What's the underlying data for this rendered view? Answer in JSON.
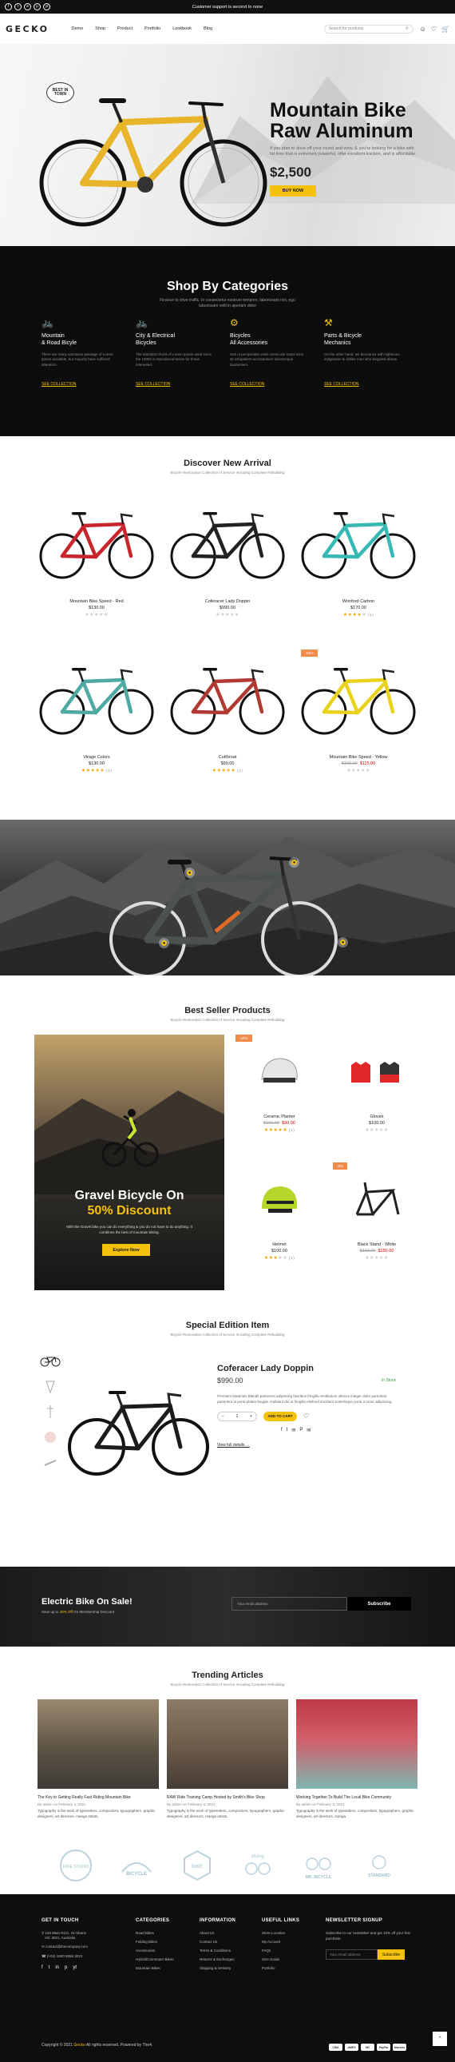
{
  "topbar": {
    "social": [
      "f",
      "t",
      "in",
      "p",
      "yt"
    ],
    "message": "Customer support is second to none"
  },
  "header": {
    "logo": "GECKO",
    "nav": [
      "Demo",
      "Shop",
      "Product",
      "Portfolio",
      "Lookbook",
      "Blog"
    ],
    "search_placeholder": "Search for products",
    "icons": [
      "user-icon",
      "heart-icon",
      "cart-icon"
    ]
  },
  "hero": {
    "bubble": "BEST IN TOWN",
    "title_line1": "Mountain Bike",
    "title_line2": "Raw Aluminum",
    "desc": "If you plan to drive off your round and wow, & you're looking for a bike with fat tires that is extremely powerful, offer excellent traction, and is affordable.",
    "price": "$2,500",
    "button": "BUY NOW"
  },
  "categories": {
    "title": "Shop By Categories",
    "subtitle": "Finance to drive traffic. In consectetur nostrum tempore, laboriosam nisi, ego laboriosam velit in aperiam dolor",
    "items": [
      {
        "name_line1": "Mountain",
        "name_line2": "& Road Bicyle",
        "desc": "There are many variations passage of Lorem Ipsum available, but majority have suffered alteration.",
        "link": "SEE COLLECTION"
      },
      {
        "name_line1": "City & Electrical",
        "name_line2": "Bicycles",
        "desc": "The standard chunk of Lorem Ipsum used since the 1500s is reproduced below for those interested.",
        "link": "SEE COLLECTION"
      },
      {
        "name_line1": "Bicycles",
        "name_line2": "All Accessories",
        "desc": "Sed ut perspiciatis unde omnis iste natus error sit voluptatem accusantium doloremque laudantium.",
        "link": "SEE COLLECTION"
      },
      {
        "name_line1": "Parts & Bicycle",
        "name_line2": "Mechanics",
        "desc": "On the other hand, we denounce with righteous indignation & dislike men who beguiled abuse.",
        "link": "SEE COLLECTION"
      }
    ]
  },
  "arrivals": {
    "title": "Discover New Arrival",
    "subtitle": "Bicycle Restoration Collection of Service Including Complete Rebuilding",
    "products": [
      {
        "name": "Mountain Bike Speed - Red",
        "price": "$130.00",
        "old": "",
        "rating": 0,
        "count": "",
        "badge": "",
        "frame": "#c8262c"
      },
      {
        "name": "Coferacer Lady Doppin",
        "price": "$990.00",
        "old": "",
        "rating": 0,
        "count": "",
        "badge": "",
        "frame": "#222222"
      },
      {
        "name": "Wonford Carbon",
        "price": "$170.00",
        "old": "",
        "rating": 4,
        "count": "(1)",
        "badge": "",
        "frame": "#36b9b5"
      },
      {
        "name": "Virage Colors",
        "price": "$130.00",
        "old": "",
        "rating": 5,
        "count": "(1)",
        "badge": "",
        "frame": "#4ea9a3"
      },
      {
        "name": "Cutthroat",
        "price": "$99.00",
        "old": "",
        "rating": 5,
        "count": "(1)",
        "badge": "",
        "frame": "#b03a32"
      },
      {
        "name": "Mountain Bike Speed - Yellow",
        "price": "$115.00",
        "old": "$100.00",
        "rating": 0,
        "count": "",
        "badge": "-15%",
        "frame": "#e8d21c"
      }
    ]
  },
  "bestseller": {
    "title": "Best Seller Products",
    "subtitle": "Bicycle Restoration Collection of Service Including Complete Rebuilding",
    "promo_title_line1": "Gravel Bicycle On",
    "promo_highlight": "50% Discount",
    "promo_desc": "With the Gravel bike you can do everything & you do not have to do anything. It combines the best of mountain biking.",
    "promo_button": "Explore Now",
    "products": [
      {
        "name": "Ceramic Planter",
        "price": "$90.00",
        "old": "$100.00",
        "rating": 5,
        "count": "(1)",
        "badge": "-10%"
      },
      {
        "name": "Gloves",
        "price": "$100.00",
        "old": "",
        "rating": 0,
        "count": "",
        "badge": ""
      },
      {
        "name": "Helmet",
        "price": "$100.00",
        "old": "",
        "rating": 3,
        "count": "(1)",
        "badge": ""
      },
      {
        "name": "Black Stand - White",
        "price": "$150.00",
        "old": "$160.00",
        "rating": 0,
        "count": "",
        "badge": "-6%"
      }
    ]
  },
  "special": {
    "title": "Special Edition Item",
    "subtitle": "Bicycle Restoration Collection of Service Including Complete Rebuilding",
    "name": "Coferacer Lady Doppin",
    "price": "$990.00",
    "stock": "In Stock",
    "desc": "Premium Materials Blandit parturient adipiscing faucibus fringilla vestibulum ultrices integer dolor parturient parturient at porta platea feugiat. Habitant dui ut fringilla eleifend tincidunt scelerisque porta a tortor adipiscing.",
    "qty": "1",
    "add_to_cart": "ADD TO CART",
    "view_link": "View full details →",
    "shares": [
      "f",
      "t",
      "✉",
      "P",
      "✉"
    ]
  },
  "ebike": {
    "title": "Electric Bike On Sale!",
    "sub_pre": "Save up to",
    "sub_highlight": "40% Off",
    "sub_post": "On Membership Discount",
    "placeholder": "Your email address",
    "button": "Subscribe"
  },
  "trending": {
    "title": "Trending Articles",
    "subtitle": "Bicycle Restoration Collection of Service Including Complete Rebuilding",
    "articles": [
      {
        "title": "The Key to Getting Really Fast Riding Mountain Bike",
        "by": "By admin on February 3, 2021",
        "text": "Typography is the work of typesetters, compositors, typographers, graphic designers, art directors, manga artists,"
      },
      {
        "title": "RAW Ride Training Camp Hosted by Smith's Bike Shop",
        "by": "By admin on February 3, 2021",
        "text": "Typography is the work of typesetters, compositors, typographers, graphic designers, art directors, manga artists,"
      },
      {
        "title": "Working Together To Build The Local Bike Community",
        "by": "By admin on February 3, 2021",
        "text": "Typography is the work of typesetters, compositors, typographers, graphic designers, art directors, manga"
      }
    ],
    "brands": [
      "RIDE STUDIO",
      "BICYCLE",
      "BIKE",
      "Riding",
      "MR. BICYCLE",
      "STANDARD"
    ]
  },
  "footer": {
    "getintouch": {
      "title": "GET IN TOUCH",
      "address_line1": "184 Main Rd E, St Albans",
      "address_line2": "VIC 3021, Australia",
      "email": "contact@thecompany.com",
      "phone": "(+02) 1800 5656 3010"
    },
    "categories": {
      "title": "CATEGORIES",
      "items": [
        "Road Bikes",
        "Folding Bikes",
        "Accessories",
        "Hybrid/Commuter Bikes",
        "Mountain Bikes"
      ]
    },
    "information": {
      "title": "INFORMATION",
      "items": [
        "About Us",
        "Contact Us",
        "Terms & Conditions",
        "Returns & Exchanges",
        "Shipping & Delivery"
      ]
    },
    "useful": {
      "title": "USEFUL LINKS",
      "items": [
        "Store Location",
        "My Account",
        "FAQs",
        "Size Guide",
        "Portfolio"
      ]
    },
    "newsletter": {
      "title": "NEWSLETTER SIGNUP",
      "desc": "Subscribe to our newsletter and get 10% off your first purchase",
      "placeholder": "Your email address",
      "button": "Subscribe"
    },
    "copy_pre": "Copyright © 2021",
    "copy_brand": "Gecko",
    "copy_post": "All rights reserved. Powered by The4.",
    "payments": [
      "VISA",
      "AMEX",
      "MC",
      "PayPal",
      "Maestro"
    ]
  },
  "colors": {
    "accent": "#f4c20d",
    "sale": "#dd0000",
    "badge": "#f08b4a"
  }
}
